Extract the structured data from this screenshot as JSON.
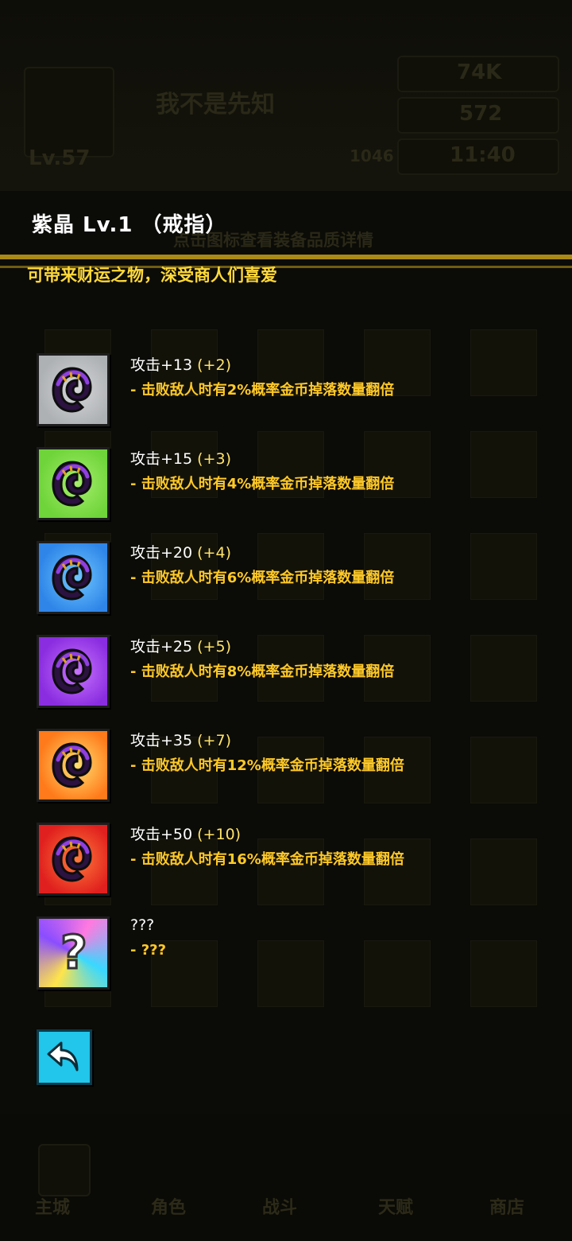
{
  "item": {
    "title": "紫晶  Lv.1 （戒指）",
    "description": "可带来财运之物，深受商人们喜爱"
  },
  "tiers": [
    {
      "stat": "攻击+13",
      "bonus": "(+2)",
      "effect": "- 击败敌人时有2%概率金币掉落数量翻倍",
      "bg": "#d4d6d8",
      "bg2": "#aeb1b4"
    },
    {
      "stat": "攻击+15",
      "bonus": "(+3)",
      "effect": "- 击败敌人时有4%概率金币掉落数量翻倍",
      "bg": "#a5ee6b",
      "bg2": "#6fd43a"
    },
    {
      "stat": "攻击+20",
      "bonus": "(+4)",
      "effect": "- 击败敌人时有6%概率金币掉落数量翻倍",
      "bg": "#6fc6ff",
      "bg2": "#2f86e8"
    },
    {
      "stat": "攻击+25",
      "bonus": "(+5)",
      "effect": "- 击败敌人时有8%概率金币掉落数量翻倍",
      "bg": "#c873ff",
      "bg2": "#8a2de0"
    },
    {
      "stat": "攻击+35",
      "bonus": "(+7)",
      "effect": "- 击败敌人时有12%概率金币掉落数量翻倍",
      "bg": "#ffe070",
      "bg2": "#ff7a1a"
    },
    {
      "stat": "攻击+50",
      "bonus": "(+10)",
      "effect": "- 击败敌人时有16%概率金币掉落数量翻倍",
      "bg": "#ff7a3a",
      "bg2": "#e0201e"
    },
    {
      "stat": "???",
      "bonus": "",
      "effect": "- ???",
      "bg": "#ff7ae0",
      "bg2": "#39d8ff"
    }
  ],
  "background": {
    "name": "我不是先知",
    "level": "Lv.57",
    "hint": "点击图标查看装备品质详情",
    "coins": "74K",
    "gems": "572",
    "power": "1046",
    "energy": "11:40",
    "nav": [
      "主城",
      "角色",
      "战斗",
      "天赋",
      "商店"
    ]
  },
  "back_label": "back-arrow-icon"
}
